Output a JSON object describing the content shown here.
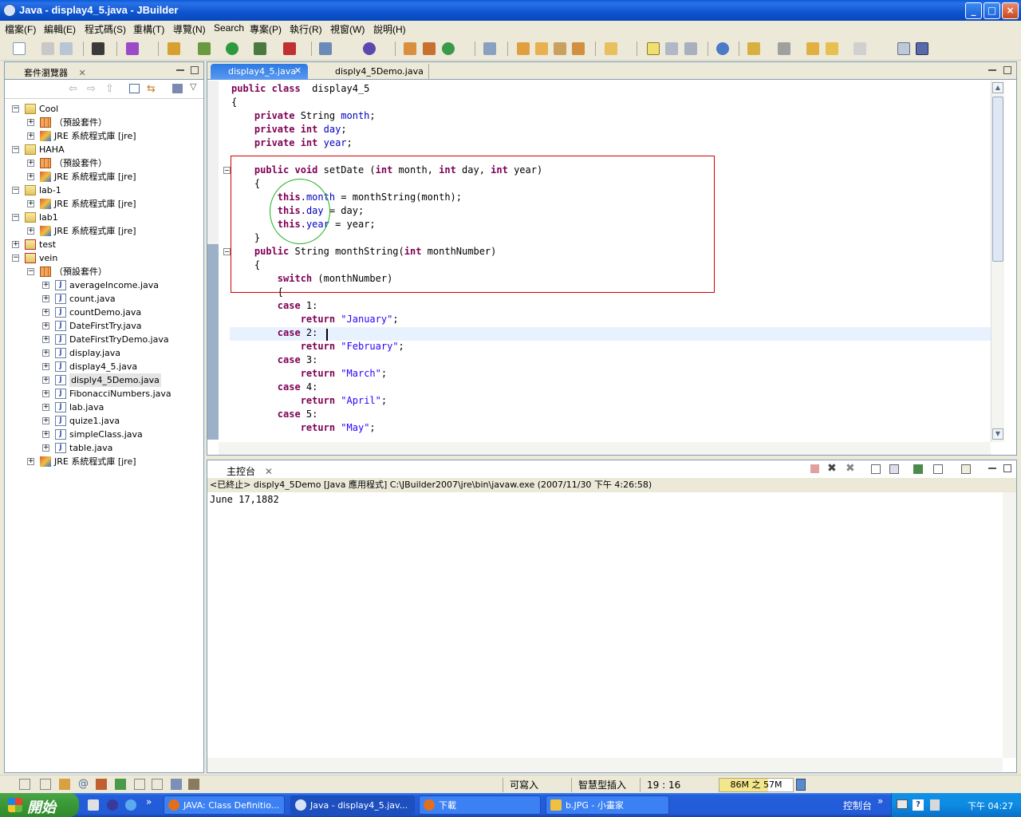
{
  "window": {
    "title": "Java - display4_5.java - JBuilder",
    "min": "_",
    "max": "□",
    "close": "×"
  },
  "menu": [
    "檔案(F)",
    "編輯(E)",
    "程式碼(S)",
    "重構(T)",
    "導覽(N)",
    "Search",
    "專案(P)",
    "執行(R)",
    "視窗(W)",
    "說明(H)"
  ],
  "explorer": {
    "tab": "套件瀏覽器",
    "items": [
      {
        "label": "Cool",
        "expander": "−",
        "icon": "proj"
      },
      {
        "label": "（預設套件）",
        "expander": "+",
        "icon": "pkg"
      },
      {
        "label": "JRE 系統程式庫 [jre]",
        "expander": "+",
        "icon": "jar"
      },
      {
        "label": "HAHA",
        "expander": "−",
        "icon": "proj"
      },
      {
        "label": "（預設套件）",
        "expander": "+",
        "icon": "pkg"
      },
      {
        "label": "JRE 系統程式庫 [jre]",
        "expander": "+",
        "icon": "jar"
      },
      {
        "label": "lab-1",
        "expander": "−",
        "icon": "proj"
      },
      {
        "label": "JRE 系統程式庫 [jre]",
        "expander": "+",
        "icon": "jar"
      },
      {
        "label": "lab1",
        "expander": "−",
        "icon": "proj"
      },
      {
        "label": "JRE 系統程式庫 [jre]",
        "expander": "+",
        "icon": "jar"
      },
      {
        "label": "test",
        "expander": "+",
        "icon": "projerr"
      },
      {
        "label": "vein",
        "expander": "−",
        "icon": "projerr"
      },
      {
        "label": "（預設套件）",
        "expander": "−",
        "icon": "pkg"
      },
      {
        "label": "averageIncome.java",
        "expander": "+",
        "icon": "jfile"
      },
      {
        "label": "count.java",
        "expander": "+",
        "icon": "jfile"
      },
      {
        "label": "countDemo.java",
        "expander": "+",
        "icon": "jfile"
      },
      {
        "label": "DateFirstTry.java",
        "expander": "+",
        "icon": "jfile"
      },
      {
        "label": "DateFirstTryDemo.java",
        "expander": "+",
        "icon": "jfile"
      },
      {
        "label": "display.java",
        "expander": "+",
        "icon": "jfile"
      },
      {
        "label": "display4_5.java",
        "expander": "+",
        "icon": "jfile"
      },
      {
        "label": "disply4_5Demo.java",
        "expander": "+",
        "icon": "jfile"
      },
      {
        "label": "FibonacciNumbers.java",
        "expander": "+",
        "icon": "jfile"
      },
      {
        "label": "lab.java",
        "expander": "+",
        "icon": "jfile"
      },
      {
        "label": "quize1.java",
        "expander": "+",
        "icon": "jfile"
      },
      {
        "label": "simpleClass.java",
        "expander": "+",
        "icon": "jfile"
      },
      {
        "label": "table.java",
        "expander": "+",
        "icon": "jfile"
      },
      {
        "label": "JRE 系統程式庫 [jre]",
        "expander": "+",
        "icon": "jar"
      }
    ]
  },
  "editor": {
    "tabs": [
      "display4_5.java",
      "disply4_5Demo.java"
    ],
    "code": [
      [
        [
          "kw",
          "public class"
        ],
        [
          "",
          "  display4_5"
        ]
      ],
      [
        [
          "",
          "{"
        ]
      ],
      [
        [
          "",
          "    "
        ],
        [
          "kw",
          "private"
        ],
        [
          "",
          " String "
        ],
        [
          "fld",
          "month"
        ],
        [
          "",
          ";"
        ]
      ],
      [
        [
          "",
          "    "
        ],
        [
          "kw",
          "private int"
        ],
        [
          "",
          " "
        ],
        [
          "fld",
          "day"
        ],
        [
          "",
          ";"
        ]
      ],
      [
        [
          "",
          "    "
        ],
        [
          "kw",
          "private int"
        ],
        [
          "",
          " "
        ],
        [
          "fld",
          "year"
        ],
        [
          "",
          ";"
        ]
      ],
      [
        [
          "",
          ""
        ]
      ],
      [
        [
          "",
          "    "
        ],
        [
          "kw",
          "public void"
        ],
        [
          "",
          " setDate ("
        ],
        [
          "kw",
          "int"
        ],
        [
          "",
          " month, "
        ],
        [
          "kw",
          "int"
        ],
        [
          "",
          " day, "
        ],
        [
          "kw",
          "int"
        ],
        [
          "",
          " year)"
        ]
      ],
      [
        [
          "",
          "    {"
        ]
      ],
      [
        [
          "",
          "        "
        ],
        [
          "kw",
          "this"
        ],
        [
          "",
          "."
        ],
        [
          "fld",
          "month"
        ],
        [
          "",
          " = monthString(month);"
        ]
      ],
      [
        [
          "",
          "        "
        ],
        [
          "kw",
          "this"
        ],
        [
          "",
          "."
        ],
        [
          "fld",
          "day"
        ],
        [
          "",
          " = day;"
        ]
      ],
      [
        [
          "",
          "        "
        ],
        [
          "kw",
          "this"
        ],
        [
          "",
          "."
        ],
        [
          "fld",
          "year"
        ],
        [
          "",
          " = year;"
        ]
      ],
      [
        [
          "",
          "    }"
        ]
      ],
      [
        [
          "",
          "    "
        ],
        [
          "kw",
          "public"
        ],
        [
          "",
          " String monthString("
        ],
        [
          "kw",
          "int"
        ],
        [
          "",
          " monthNumber)"
        ]
      ],
      [
        [
          "",
          "    {"
        ]
      ],
      [
        [
          "",
          "        "
        ],
        [
          "kw",
          "switch"
        ],
        [
          "",
          " (monthNumber)"
        ]
      ],
      [
        [
          "",
          "        {"
        ]
      ],
      [
        [
          "",
          "        "
        ],
        [
          "kw",
          "case"
        ],
        [
          "",
          " 1:"
        ]
      ],
      [
        [
          "",
          "            "
        ],
        [
          "kw",
          "return"
        ],
        [
          "",
          " "
        ],
        [
          "str",
          "\"January\""
        ],
        [
          "",
          ";"
        ]
      ],
      [
        [
          "",
          "        "
        ],
        [
          "kw",
          "case"
        ],
        [
          "",
          " 2:"
        ]
      ],
      [
        [
          "",
          "            "
        ],
        [
          "kw",
          "return"
        ],
        [
          "",
          " "
        ],
        [
          "str",
          "\"February\""
        ],
        [
          "",
          ";"
        ]
      ],
      [
        [
          "",
          "        "
        ],
        [
          "kw",
          "case"
        ],
        [
          "",
          " 3:"
        ]
      ],
      [
        [
          "",
          "            "
        ],
        [
          "kw",
          "return"
        ],
        [
          "",
          " "
        ],
        [
          "str",
          "\"March\""
        ],
        [
          "",
          ";"
        ]
      ],
      [
        [
          "",
          "        "
        ],
        [
          "kw",
          "case"
        ],
        [
          "",
          " 4:"
        ]
      ],
      [
        [
          "",
          "            "
        ],
        [
          "kw",
          "return"
        ],
        [
          "",
          " "
        ],
        [
          "str",
          "\"April\""
        ],
        [
          "",
          ";"
        ]
      ],
      [
        [
          "",
          "        "
        ],
        [
          "kw",
          "case"
        ],
        [
          "",
          " 5:"
        ]
      ],
      [
        [
          "",
          "            "
        ],
        [
          "kw",
          "return"
        ],
        [
          "",
          " "
        ],
        [
          "str",
          "\"May\""
        ],
        [
          "",
          ";"
        ]
      ]
    ]
  },
  "console": {
    "tab": "主控台",
    "header": "<已終止> disply4_5Demo [Java 應用程式] C:\\JBuilder2007\\jre\\bin\\javaw.exe (2007/11/30 下午 4:26:58)",
    "output": "June 17,1882"
  },
  "status": {
    "writable": "可寫入",
    "insert": "智慧型插入",
    "position": "19 : 16",
    "memory": "86M 之 57M"
  },
  "taskbar": {
    "start": "開始",
    "buttons": [
      "JAVA: Class Definitio...",
      "Java - display4_5.jav...",
      "下載",
      "b.JPG - 小畫家"
    ],
    "tray_label": "控制台",
    "clock": "下午 04:27"
  },
  "colors": {
    "keyword": "#7f0055",
    "field": "#0000c0",
    "string": "#2a00ff",
    "highlight_box": "#d00000",
    "circle": "#20b020"
  }
}
